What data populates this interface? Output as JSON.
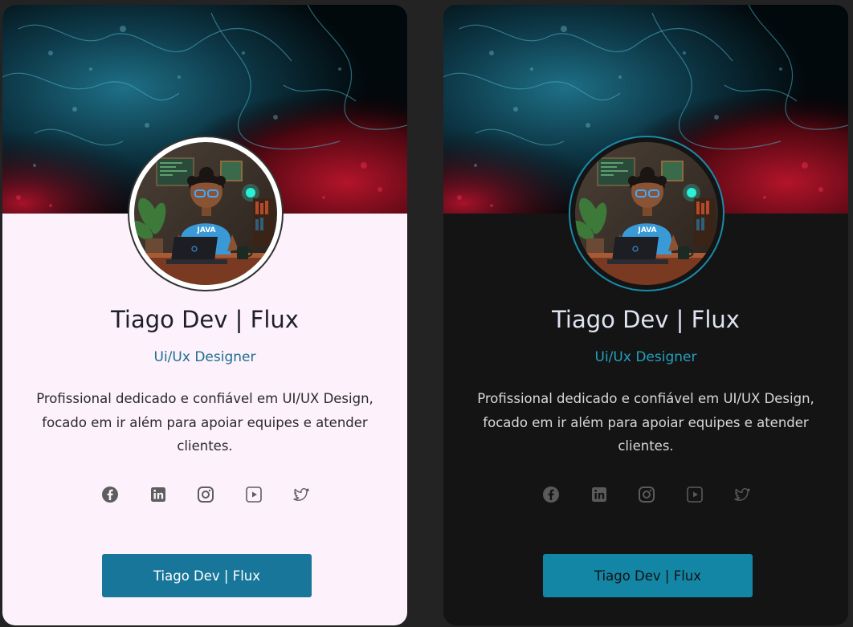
{
  "cards": [
    {
      "theme": "light",
      "name": "Tiago Dev | Flux",
      "role": "Ui/Ux Designer",
      "bio": "Profissional dedicado e confiável em UI/UX Design, focado em ir além para apoiar equipes e atender clientes.",
      "socials": [
        "facebook-icon",
        "linkedin-icon",
        "instagram-icon",
        "youtube-icon",
        "twitter-icon"
      ],
      "button_label": "Tiago Dev | Flux",
      "colors": {
        "background": "#fdf1fb",
        "accent": "#177699",
        "name": "#1f1f2a"
      }
    },
    {
      "theme": "dark",
      "name": "Tiago Dev | Flux",
      "role": "Ui/Ux Designer",
      "bio": "Profissional dedicado e confiável em UI/UX Design, focado em ir além para apoiar equipes e atender clientes.",
      "socials": [
        "facebook-icon",
        "linkedin-icon",
        "instagram-icon",
        "youtube-icon",
        "twitter-icon"
      ],
      "button_label": "Tiago Dev | Flux",
      "colors": {
        "background": "#141414",
        "accent": "#1486a5",
        "name": "#dfe3f2"
      }
    }
  ],
  "avatar_text": "JAVA"
}
